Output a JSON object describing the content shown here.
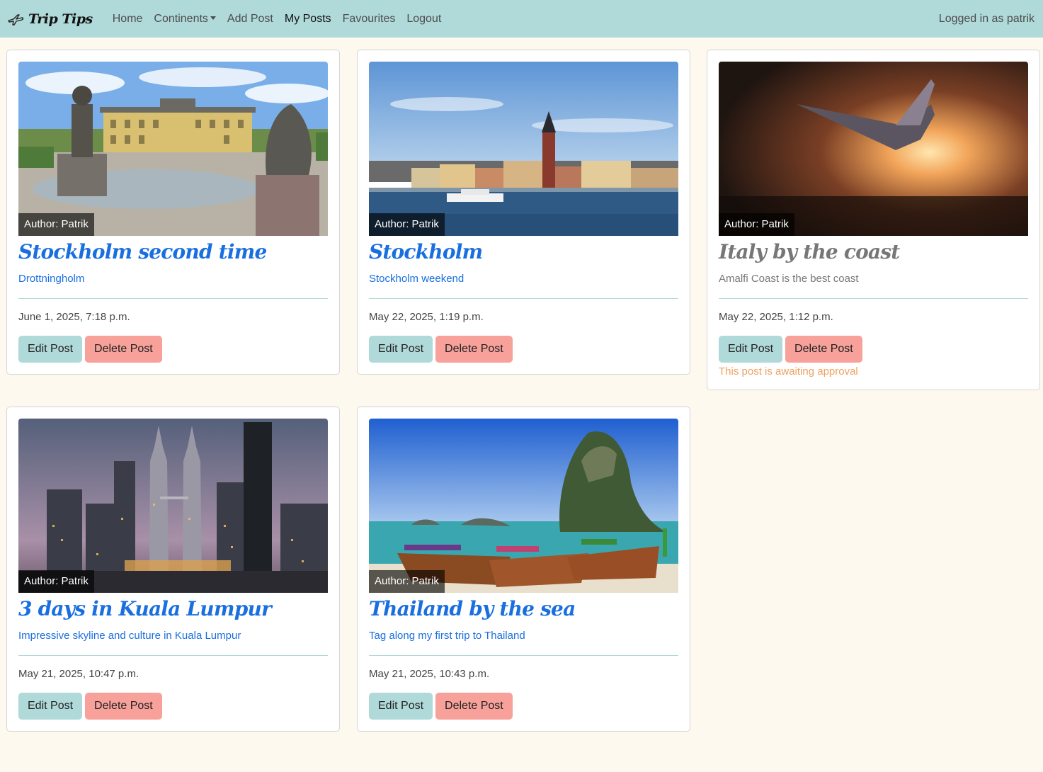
{
  "navbar": {
    "brand": "Trip Tips",
    "links": {
      "home": "Home",
      "continents": "Continents",
      "add_post": "Add Post",
      "my_posts": "My Posts",
      "favourites": "Favourites",
      "logout": "Logout"
    },
    "logged_in": "Logged in as patrik"
  },
  "posts": [
    {
      "author": "Author: Patrik",
      "title": "Stockholm second time",
      "excerpt": "Drottningholm",
      "date": "June 1, 2025, 7:18 p.m.",
      "edit_label": "Edit Post",
      "delete_label": "Delete Post"
    },
    {
      "author": "Author: Patrik",
      "title": "Stockholm",
      "excerpt": "Stockholm weekend",
      "date": "May 22, 2025, 1:19 p.m.",
      "edit_label": "Edit Post",
      "delete_label": "Delete Post"
    },
    {
      "author": "Author: Patrik",
      "title": "Italy by the coast",
      "excerpt": "Amalfi Coast is the best coast",
      "date": "May 22, 2025, 1:12 p.m.",
      "edit_label": "Edit Post",
      "delete_label": "Delete Post",
      "status": "This post is awaiting approval"
    },
    {
      "author": "Author: Patrik",
      "title": "3 days in Kuala Lumpur",
      "excerpt": "Impressive skyline and culture in Kuala Lumpur",
      "date": "May 21, 2025, 10:47 p.m.",
      "edit_label": "Edit Post",
      "delete_label": "Delete Post"
    },
    {
      "author": "Author: Patrik",
      "title": "Thailand by the sea",
      "excerpt": "Tag along my first trip to Thailand",
      "date": "May 21, 2025, 10:43 p.m.",
      "edit_label": "Edit Post",
      "delete_label": "Delete Post"
    }
  ],
  "colors": {
    "navbar_bg": "#b0d9d9",
    "page_bg": "#fef9ee",
    "title_link": "#1a6fe0",
    "edit_button": "#b0d9d9",
    "delete_button": "#f7a19a",
    "awaiting_text": "#f0a060"
  }
}
